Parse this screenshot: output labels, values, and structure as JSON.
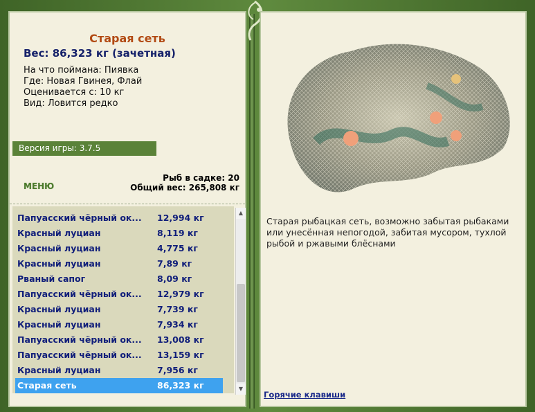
{
  "item": {
    "title": "Старая сеть",
    "weight_line": "Вес: 86,323 кг (зачетная)",
    "caught_on": "На что поймана: Пиявка",
    "location": "Где: Новая Гвинея, Флай",
    "counted_from": "Оценивается с: 10 кг",
    "kind": "Вид: Ловится редко"
  },
  "version": "Версия игры: 3.7.5",
  "menu_label": "МЕНЮ",
  "keep": {
    "count_line": "Рыб в садке: 20",
    "total_line": "Общий вес: 265,808 кг"
  },
  "catch_list": [
    {
      "name": "Папуасский чёрный ок...",
      "weight": "12,994 кг"
    },
    {
      "name": "Красный луциан",
      "weight": "8,119 кг"
    },
    {
      "name": "Красный луциан",
      "weight": "4,775 кг"
    },
    {
      "name": "Красный луциан",
      "weight": "7,89 кг"
    },
    {
      "name": "Рваный сапог",
      "weight": "8,09 кг"
    },
    {
      "name": "Папуасский чёрный ок...",
      "weight": "12,979 кг"
    },
    {
      "name": "Красный луциан",
      "weight": "7,739 кг"
    },
    {
      "name": "Красный луциан",
      "weight": "7,934 кг"
    },
    {
      "name": "Папуасский чёрный ок...",
      "weight": "13,008 кг"
    },
    {
      "name": "Папуасский чёрный ок...",
      "weight": "13,159 кг"
    },
    {
      "name": "Красный луциан",
      "weight": "7,956 кг"
    },
    {
      "name": "Старая сеть",
      "weight": "86,323 кг",
      "selected": true
    }
  ],
  "description": "Старая рыбацкая сеть, возможно забытая рыбаками или унесённая непогодой, забитая мусором, тухлой рыбой и ржавыми блёснами",
  "hotkeys_label": "Горячие клавиши",
  "colors": {
    "accent_green": "#5a8238",
    "selected_row": "#3ea2ef",
    "title": "#b24a13",
    "list_text": "#101e7a"
  }
}
